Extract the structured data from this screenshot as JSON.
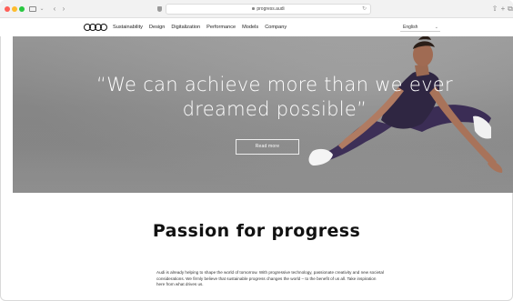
{
  "browser": {
    "url": "progress.audi",
    "reload_glyph": "↻",
    "back_glyph": "‹",
    "forward_glyph": "›",
    "dropdown_glyph": "⌄",
    "share_glyph": "⇧",
    "newtab_glyph": "+",
    "tabs_glyph": "⧉"
  },
  "nav": {
    "items": [
      "Sustainability",
      "Design",
      "Digitalization",
      "Performance",
      "Models",
      "Company"
    ],
    "language": "English",
    "language_chevron": "⌄"
  },
  "hero": {
    "quote": "“We can achieve more than we ever dreamed possible”",
    "button_label": "Read more"
  },
  "content": {
    "title": "Passion for progress",
    "intro": "Audi is already helping to shape the world of tomorrow. With progressive technology, passionate creativity and new societal considerations. We firmly believe that sustainable progress changes the world – to the benefit of us all. Take inspiration here from what drives us."
  },
  "colors": {
    "traffic_red": "#fe5f57",
    "traffic_yellow": "#febc2e",
    "traffic_green": "#28c840",
    "hero_bg": "#8d8d8d",
    "athlete_outfit": "#3d2f57"
  }
}
